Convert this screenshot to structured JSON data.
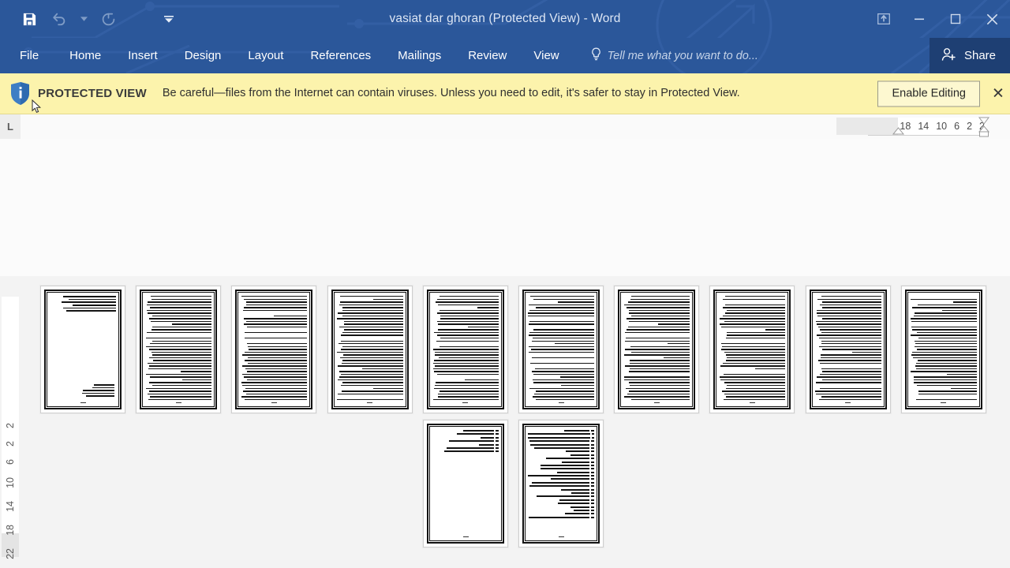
{
  "window": {
    "title": "vasiat dar ghoran (Protected View) - Word",
    "accent_color": "#2b579a",
    "share_bg": "#1e3f73"
  },
  "quick_access": {
    "items": [
      {
        "name": "save-button",
        "icon": "save-icon",
        "enabled": true
      },
      {
        "name": "undo-button",
        "icon": "undo-icon",
        "enabled": false
      },
      {
        "name": "undo-dropdown",
        "icon": "chevron-down-icon",
        "enabled": false
      },
      {
        "name": "redo-button",
        "icon": "redo-icon",
        "enabled": false
      },
      {
        "name": "customize-quick-access-toolbar",
        "icon": "chevron-down-icon",
        "enabled": true
      }
    ]
  },
  "window_controls": {
    "ribbon_display_options": "ribbon-display-options-icon",
    "minimize": "minimize-icon",
    "restore": "restore-icon",
    "close": "close-icon"
  },
  "ribbon": {
    "tabs": [
      {
        "label": "File"
      },
      {
        "label": "Home"
      },
      {
        "label": "Insert"
      },
      {
        "label": "Design"
      },
      {
        "label": "Layout"
      },
      {
        "label": "References"
      },
      {
        "label": "Mailings"
      },
      {
        "label": "Review"
      },
      {
        "label": "View"
      }
    ],
    "tell_me": "Tell me what you want to do...",
    "share_label": "Share"
  },
  "protected_view": {
    "badge": "PROTECTED VIEW",
    "message": "Be careful—files from the Internet can contain viruses. Unless you need to edit, it's safer to stay in Protected View.",
    "enable_label": "Enable Editing",
    "close_label": "✕",
    "bg_color": "#fcf3ac"
  },
  "ruler": {
    "tab_stop_selector": "L",
    "horizontal_marks": [
      "18",
      "14",
      "10",
      "6",
      "2",
      "2"
    ],
    "vertical_marks": [
      "2",
      "2",
      "6",
      "10",
      "14",
      "18",
      "22"
    ]
  },
  "document": {
    "zoom_view": "multiple-pages",
    "pages": [
      {
        "index": 1,
        "style": "title",
        "lines": 6,
        "row": 1
      },
      {
        "index": 2,
        "style": "dense",
        "lines": 46,
        "row": 1
      },
      {
        "index": 3,
        "style": "dense",
        "lines": 46,
        "row": 1
      },
      {
        "index": 4,
        "style": "dense",
        "lines": 46,
        "row": 1
      },
      {
        "index": 5,
        "style": "dense",
        "lines": 46,
        "row": 1
      },
      {
        "index": 6,
        "style": "dense",
        "lines": 46,
        "row": 1
      },
      {
        "index": 7,
        "style": "dense",
        "lines": 46,
        "row": 1
      },
      {
        "index": 8,
        "style": "dense",
        "lines": 46,
        "row": 1
      },
      {
        "index": 9,
        "style": "dense",
        "lines": 46,
        "row": 1
      },
      {
        "index": 10,
        "style": "dense",
        "lines": 46,
        "row": 1
      },
      {
        "index": 11,
        "style": "index",
        "lines": 7,
        "row": 2
      },
      {
        "index": 12,
        "style": "index",
        "lines": 26,
        "row": 2
      }
    ]
  }
}
